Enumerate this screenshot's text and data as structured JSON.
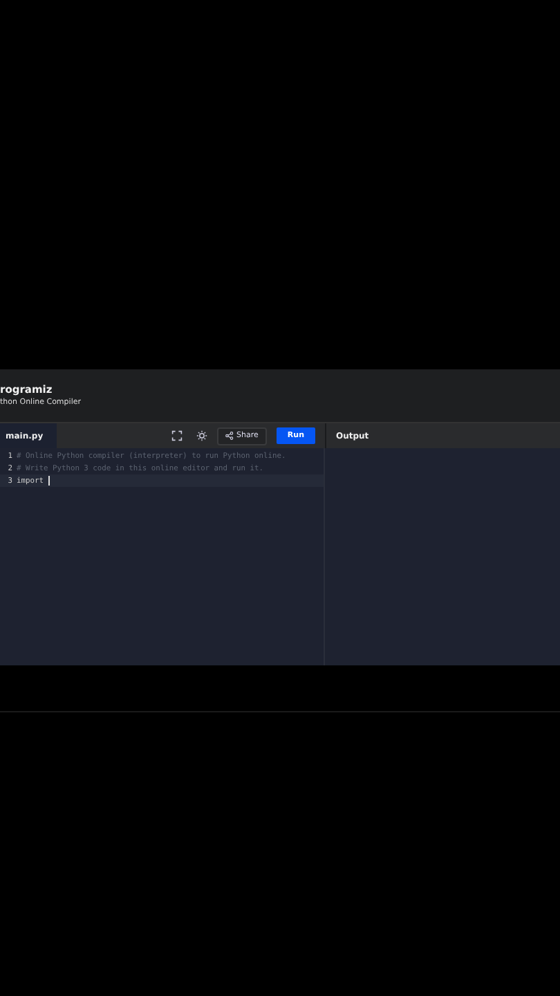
{
  "header": {
    "logo": "rogramiz",
    "subtitle": "thon Online Compiler"
  },
  "toolbar": {
    "file_tab": {
      "label": "main.py",
      "selected": true
    },
    "share": "Share",
    "run": "Run"
  },
  "editor": {
    "lines": [
      {
        "number": "1",
        "text": "# Online Python compiler (interpreter) to run Python online.",
        "kind": "comment",
        "active": false
      },
      {
        "number": "2",
        "text": "# Write Python 3 code in this online editor and run it.",
        "kind": "comment",
        "active": false
      },
      {
        "number": "3",
        "text": "import ",
        "kind": "code",
        "active": true
      }
    ]
  },
  "output": {
    "title": "Output"
  }
}
